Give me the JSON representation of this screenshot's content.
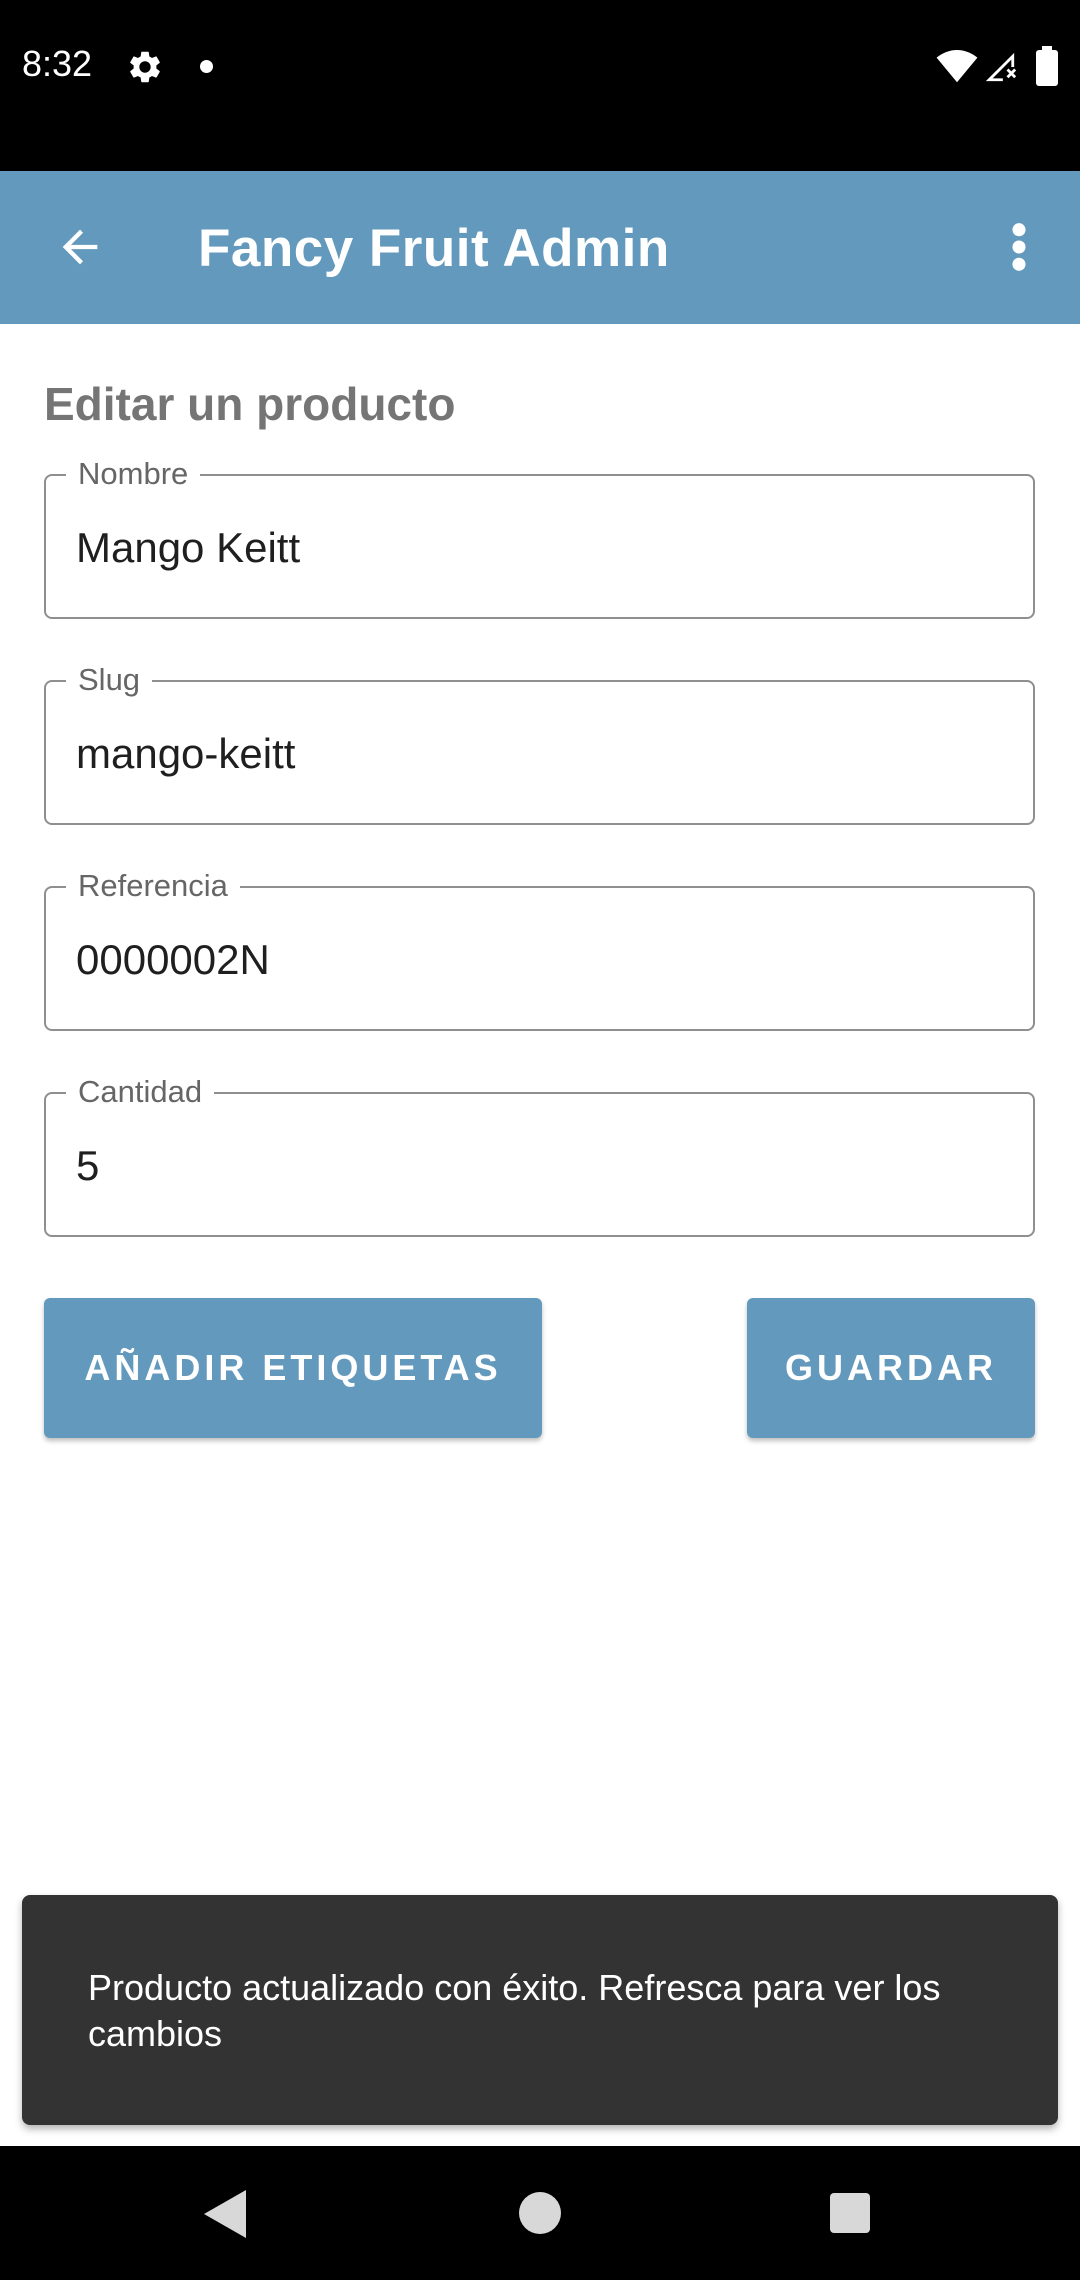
{
  "status_bar": {
    "time": "8:32"
  },
  "app_bar": {
    "title": "Fancy Fruit Admin"
  },
  "page": {
    "heading": "Editar un producto"
  },
  "form": {
    "fields": [
      {
        "label": "Nombre",
        "value": "Mango Keitt"
      },
      {
        "label": "Slug",
        "value": "mango-keitt"
      },
      {
        "label": "Referencia",
        "value": "0000002N"
      },
      {
        "label": "Cantidad",
        "value": "5"
      }
    ],
    "add_tags_label": "AÑADIR ETIQUETAS",
    "save_label": "GUARDAR"
  },
  "snackbar": {
    "message": "Producto actualizado con éxito. Refresca para ver los cambios"
  },
  "colors": {
    "accent": "#6399bd",
    "snackbar_bg": "#333333",
    "system_bar": "#000000"
  },
  "icons": {
    "status": [
      "gear-icon",
      "notification-dot-icon",
      "wifi-icon",
      "signal-icon",
      "battery-icon"
    ],
    "app_bar": [
      "back-arrow-icon",
      "more-vert-icon"
    ],
    "nav": [
      "nav-back-icon",
      "nav-home-icon",
      "nav-recents-icon"
    ]
  }
}
